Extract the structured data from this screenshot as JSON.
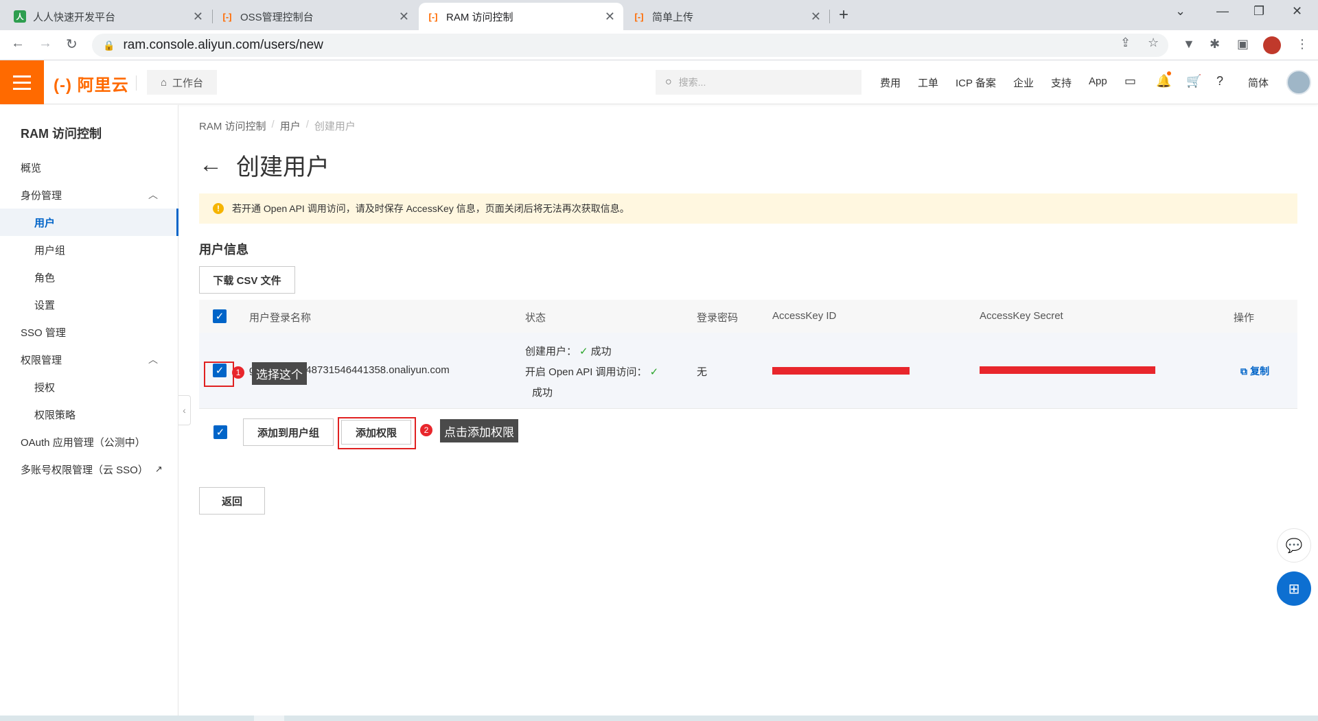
{
  "browser": {
    "tabs": [
      {
        "title": "人人快速开发平台",
        "icon": "renren-icon",
        "active": false
      },
      {
        "title": "OSS管理控制台",
        "icon": "aliyun-icon",
        "active": false
      },
      {
        "title": "RAM 访问控制",
        "icon": "aliyun-icon",
        "active": true
      },
      {
        "title": "简单上传",
        "icon": "aliyun-icon",
        "active": false
      }
    ],
    "url": "ram.console.aliyun.com/users/new"
  },
  "topbar": {
    "logo": "(-) 阿里云",
    "workbench": "工作台",
    "search_placeholder": "搜索...",
    "nav": [
      "费用",
      "工单",
      "ICP 备案",
      "企业",
      "支持",
      "App"
    ],
    "lang": "简体"
  },
  "sidebar": {
    "title": "RAM 访问控制",
    "items": [
      {
        "label": "概览",
        "level": 1
      },
      {
        "label": "身份管理",
        "level": 1,
        "expanded": true
      },
      {
        "label": "用户",
        "level": 2,
        "active": true
      },
      {
        "label": "用户组",
        "level": 2
      },
      {
        "label": "角色",
        "level": 2
      },
      {
        "label": "设置",
        "level": 2
      },
      {
        "label": "SSO 管理",
        "level": 1
      },
      {
        "label": "权限管理",
        "level": 1,
        "expanded": true
      },
      {
        "label": "授权",
        "level": 2
      },
      {
        "label": "权限策略",
        "level": 2
      },
      {
        "label": "OAuth 应用管理（公测中）",
        "level": 1
      },
      {
        "label": "多账号权限管理（云 SSO）",
        "level": 1
      }
    ]
  },
  "breadcrumb": [
    "RAM 访问控制",
    "用户",
    "创建用户"
  ],
  "page_title": "创建用户",
  "notice": "若开通 Open API 调用访问，请及时保存 AccessKey 信息，页面关闭后将无法再次获取信息。",
  "section_title": "用户信息",
  "download_csv": "下载 CSV 文件",
  "table": {
    "headers": [
      "用户登录名称",
      "状态",
      "登录密码",
      "AccessKey ID",
      "AccessKey Secret",
      "操作"
    ],
    "row": {
      "login_name_prefix": "g",
      "login_name_suffix": "648731546441358.onaliyun.com",
      "status_create": "创建用户：",
      "status_create_result": "成功",
      "status_api": "开启 Open API 调用访问：",
      "status_api_result": "成功",
      "password": "无",
      "action": "复制"
    }
  },
  "actions": {
    "add_to_group": "添加到用户组",
    "add_permission": "添加权限",
    "back": "返回"
  },
  "annotations": [
    {
      "num": "1",
      "text": "选择这个"
    },
    {
      "num": "2",
      "text": "点击添加权限"
    }
  ],
  "colors": {
    "brand": "#ff6a00",
    "primary": "#0064c8",
    "highlight": "#e02020"
  }
}
